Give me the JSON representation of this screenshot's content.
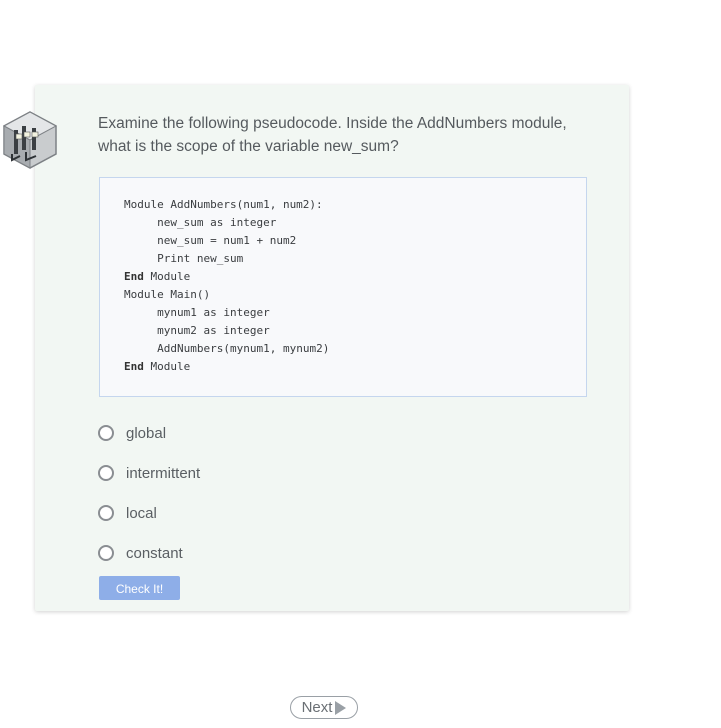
{
  "question": {
    "text": "Examine the following pseudocode. Inside the AddNumbers module, what is the scope of the variable new_sum?"
  },
  "code": {
    "lines": [
      {
        "indent": "",
        "kw": "",
        "text": "Module AddNumbers(num1, num2):"
      },
      {
        "indent": "     ",
        "kw": "",
        "text": "new_sum as integer"
      },
      {
        "indent": "     ",
        "kw": "",
        "text": "new_sum = num1 + num2"
      },
      {
        "indent": "     ",
        "kw": "",
        "text": "Print new_sum"
      },
      {
        "indent": "",
        "kw": "End",
        "text": " Module"
      },
      {
        "indent": "",
        "kw": "",
        "text": "Module Main()"
      },
      {
        "indent": "     ",
        "kw": "",
        "text": "mynum1 as integer"
      },
      {
        "indent": "     ",
        "kw": "",
        "text": "mynum2 as integer"
      },
      {
        "indent": "     ",
        "kw": "",
        "text": "AddNumbers(mynum1, mynum2)"
      },
      {
        "indent": "",
        "kw": "End",
        "text": " Module"
      }
    ]
  },
  "options": [
    {
      "label": "global"
    },
    {
      "label": "intermittent"
    },
    {
      "label": "local"
    },
    {
      "label": "constant"
    }
  ],
  "buttons": {
    "check_label": "Check It!",
    "next_label": "Next"
  },
  "colors": {
    "card_bg": "#f2f7f3",
    "check_button": "#8eaee8",
    "code_border": "#c5d6ee"
  },
  "icons": {
    "logo": "server-rack-icon",
    "next": "play-triangle-icon"
  }
}
